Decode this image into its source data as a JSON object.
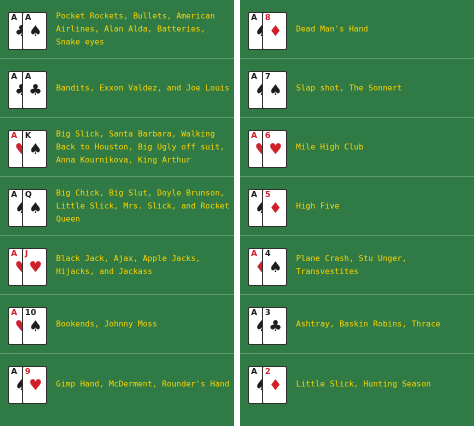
{
  "left": [
    {
      "label": "Pocket Rockets, Bullets, American Airlines, Alan Alda, Batteries, Snake eyes",
      "cards": [
        {
          "rank": "A",
          "suit": "♣",
          "color": "black"
        },
        {
          "rank": "A",
          "suit": "♠",
          "color": "black"
        }
      ]
    },
    {
      "label": "Bandits, Exxon Valdez, and Joe Louis",
      "cards": [
        {
          "rank": "A",
          "suit": "♣",
          "color": "black"
        },
        {
          "rank": "A",
          "suit": "♣",
          "color": "black"
        }
      ]
    },
    {
      "label": "Big Slick, Santa Barbara, Walking Back to Houston, Big Ugly off suit, Anna Kournikova, King Arthur",
      "cards": [
        {
          "rank": "A",
          "suit": "♥",
          "color": "red"
        },
        {
          "rank": "K",
          "suit": "♠",
          "color": "black"
        }
      ]
    },
    {
      "label": "Big Chick, Big Slut, Doyle Brunson, Little Slick, Mrs. Slick, and Rocket Queen",
      "cards": [
        {
          "rank": "A",
          "suit": "♠",
          "color": "black"
        },
        {
          "rank": "Q",
          "suit": "♠",
          "color": "black"
        }
      ]
    },
    {
      "label": "Black Jack, Ajax, Apple Jacks, Hijacks, and Jackass",
      "cards": [
        {
          "rank": "A",
          "suit": "♥",
          "color": "red"
        },
        {
          "rank": "J",
          "suit": "♥",
          "color": "red"
        }
      ]
    },
    {
      "label": "Bookends, Johnny Moss",
      "cards": [
        {
          "rank": "A",
          "suit": "♥",
          "color": "red"
        },
        {
          "rank": "10",
          "suit": "♠",
          "color": "black"
        }
      ]
    },
    {
      "label": "Gimp Hand, McDerment, Rounder's Hand",
      "cards": [
        {
          "rank": "A",
          "suit": "♠",
          "color": "black"
        },
        {
          "rank": "9",
          "suit": "♥",
          "color": "red"
        }
      ]
    }
  ],
  "right": [
    {
      "label": "Dead Man's Hand",
      "cards": [
        {
          "rank": "A",
          "suit": "♠",
          "color": "black"
        },
        {
          "rank": "8",
          "suit": "♦",
          "color": "red"
        }
      ]
    },
    {
      "label": "Slap shot, The Sonnert",
      "cards": [
        {
          "rank": "A",
          "suit": "♠",
          "color": "black"
        },
        {
          "rank": "7",
          "suit": "♠",
          "color": "black"
        }
      ]
    },
    {
      "label": "Mile High Club",
      "cards": [
        {
          "rank": "A",
          "suit": "♥",
          "color": "red"
        },
        {
          "rank": "6",
          "suit": "♥",
          "color": "red"
        }
      ]
    },
    {
      "label": "High Five",
      "cards": [
        {
          "rank": "A",
          "suit": "♠",
          "color": "black"
        },
        {
          "rank": "5",
          "suit": "♦",
          "color": "red"
        }
      ]
    },
    {
      "label": "Plane Crash, Stu Unger, Transvestites",
      "cards": [
        {
          "rank": "A",
          "suit": "♦",
          "color": "red"
        },
        {
          "rank": "4",
          "suit": "♠",
          "color": "black"
        }
      ]
    },
    {
      "label": "Ashtray, Baskin Robins, Thrace",
      "cards": [
        {
          "rank": "A",
          "suit": "♠",
          "color": "black"
        },
        {
          "rank": "3",
          "suit": "♣",
          "color": "black"
        }
      ]
    },
    {
      "label": "Little Slick, Hunting Season",
      "cards": [
        {
          "rank": "A",
          "suit": "♠",
          "color": "black"
        },
        {
          "rank": "2",
          "suit": "♦",
          "color": "red"
        }
      ]
    }
  ]
}
